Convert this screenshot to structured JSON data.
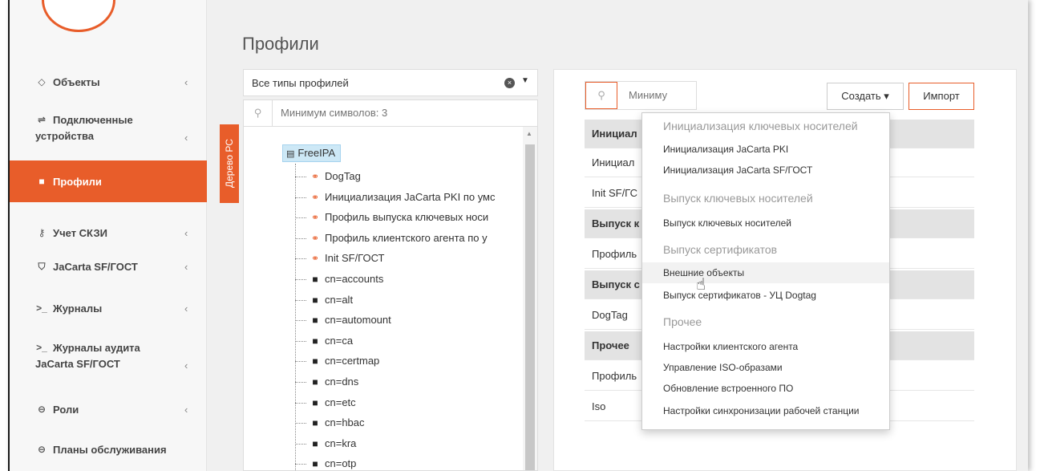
{
  "sidebar": {
    "items": [
      {
        "label": "Объекты",
        "icon": "diamond-icon",
        "has_chevron": true
      },
      {
        "label": "Подключенные устройства",
        "label_line1": "Подключенные",
        "label_line2": "устройства",
        "icon": "usb-icon",
        "has_chevron": true
      },
      {
        "label": "Профили",
        "icon": "folder-icon",
        "active": true
      },
      {
        "label": "Учет СКЗИ",
        "icon": "key-icon",
        "has_chevron": true
      },
      {
        "label": "JaCarta SF/ГОСТ",
        "icon": "shield-icon",
        "has_chevron": true
      },
      {
        "label": "Журналы",
        "icon": "terminal-icon",
        "has_chevron": true
      },
      {
        "label": "Журналы аудита JaCarta SF/ГОСТ",
        "label_line1": "Журналы аудита",
        "label_line2": "JaCarta SF/ГОСТ",
        "icon": "terminal-icon",
        "has_chevron": true
      },
      {
        "label": "Роли",
        "icon": "user-circle-icon",
        "has_chevron": true
      },
      {
        "label": "Планы обслуживания",
        "icon": "user-circle-icon"
      }
    ],
    "chevron": "‹"
  },
  "page": {
    "title": "Профили"
  },
  "profile_filter": {
    "value": "Все типы профилей"
  },
  "tree_search": {
    "placeholder": "Минимум символов: 3"
  },
  "tree_tab": {
    "label": "Дерево РС"
  },
  "tree": {
    "root": "FreeIPA",
    "nodes": [
      {
        "label": "DogTag",
        "type": "profile"
      },
      {
        "label": "Инициализация JaCarta PKI по умс",
        "type": "profile"
      },
      {
        "label": "Профиль выпуска ключевых носи",
        "type": "profile"
      },
      {
        "label": "Профиль клиентского агента по у",
        "type": "profile"
      },
      {
        "label": "Init SF/ГОСТ",
        "type": "profile"
      },
      {
        "label": "cn=accounts",
        "type": "folder"
      },
      {
        "label": "cn=alt",
        "type": "folder"
      },
      {
        "label": "cn=automount",
        "type": "folder"
      },
      {
        "label": "cn=ca",
        "type": "folder"
      },
      {
        "label": "cn=certmap",
        "type": "folder"
      },
      {
        "label": "cn=dns",
        "type": "folder"
      },
      {
        "label": "cn=etc",
        "type": "folder"
      },
      {
        "label": "cn=hbac",
        "type": "folder"
      },
      {
        "label": "cn=kra",
        "type": "folder"
      },
      {
        "label": "cn=otp",
        "type": "folder"
      }
    ]
  },
  "right_panel": {
    "search_placeholder": "Миниму",
    "create_label": "Создать",
    "import_label": "Импорт",
    "rows": [
      {
        "text": "Инициал",
        "group": true
      },
      {
        "text": "Инициал",
        "group": false
      },
      {
        "text": "Init SF/ГС",
        "group": false
      },
      {
        "text": "Выпуск к",
        "group": true
      },
      {
        "text": "Профиль",
        "group": false
      },
      {
        "text": "Выпуск с",
        "group": true
      },
      {
        "text": "DogTag",
        "group": false
      },
      {
        "text": "Прочее",
        "group": true
      },
      {
        "text": "Профиль",
        "group": false
      },
      {
        "text": "Iso",
        "group": false
      }
    ]
  },
  "dropdown": {
    "entries": [
      {
        "kind": "header",
        "label": "Инициализация ключевых носителей"
      },
      {
        "kind": "item",
        "label": "Инициализация JaCarta PKI"
      },
      {
        "kind": "item",
        "label": "Инициализация JaCarta SF/ГОСТ"
      },
      {
        "kind": "header",
        "label": "Выпуск ключевых носителей"
      },
      {
        "kind": "item",
        "label": "Выпуск ключевых носителей"
      },
      {
        "kind": "header",
        "label": "Выпуск сертификатов"
      },
      {
        "kind": "item",
        "label": "Внешние объекты",
        "hover": true
      },
      {
        "kind": "item",
        "label": "Выпуск сертификатов - УЦ Dogtag"
      },
      {
        "kind": "header",
        "label": "Прочее"
      },
      {
        "kind": "item",
        "label": "Настройки клиентского агента"
      },
      {
        "kind": "item",
        "label": "Управление ISO-образами"
      },
      {
        "kind": "item",
        "label": "Обновление встроенного ПО"
      },
      {
        "kind": "item",
        "label": "Настройки синхронизации рабочей станции"
      }
    ]
  },
  "colors": {
    "accent": "#e85d2a",
    "tree_selection": "#cde8f6",
    "group_row": "#e3e3e3"
  }
}
